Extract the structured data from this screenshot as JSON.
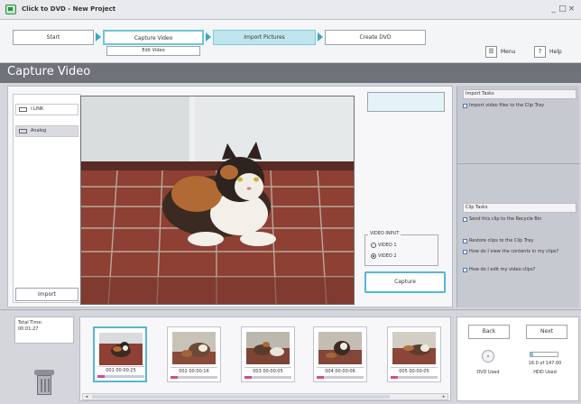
{
  "window": {
    "title": "Click to DVD - New Project"
  },
  "wizard": {
    "steps": [
      {
        "label": "Start"
      },
      {
        "label": "Capture Video"
      },
      {
        "label": "Import Pictures"
      },
      {
        "label": "Create DVD"
      }
    ],
    "substep": "Edit Video",
    "menu_label": "Menu",
    "help_label": "Help"
  },
  "page": {
    "title": "Capture Video"
  },
  "sources": [
    {
      "label": "i.LINK"
    },
    {
      "label": "Analog"
    }
  ],
  "import_label": "Import",
  "video_input": {
    "title": "VIDEO INPUT",
    "options": [
      "VIDEO 1",
      "VIDEO 2"
    ],
    "selected_index": 1
  },
  "capture_label": "Capture",
  "import_tasks": {
    "title": "Import Tasks",
    "links": [
      "Import video files to the Clip Tray"
    ]
  },
  "clip_tasks": {
    "title": "Clip Tasks",
    "links": [
      "Send this clip to the Recycle Bin",
      "Restore clips to the Clip Tray",
      "How do I view the contents in my clips?",
      "How do I edit my video clips?"
    ]
  },
  "total_time": {
    "label": "Total Time:",
    "value": "00:01:27"
  },
  "clips": [
    {
      "timecode": "001 00:00:25",
      "selected": true
    },
    {
      "timecode": "002 00:00:16",
      "selected": false
    },
    {
      "timecode": "003 00:00:05",
      "selected": false
    },
    {
      "timecode": "004 00:00:06",
      "selected": false
    },
    {
      "timecode": "005 00:00:05",
      "selected": false
    }
  ],
  "nav": {
    "back_label": "Back",
    "next_label": "Next",
    "dvd_used_label": "DVD Used",
    "hdd_value": "16.0 of 147.00",
    "hdd_used_label": "HDD Used",
    "hdd_fraction": 0.11
  },
  "colors": {
    "accent": "#55b7cf",
    "banner": "#6f7279",
    "highlight": "#d24c8e"
  }
}
